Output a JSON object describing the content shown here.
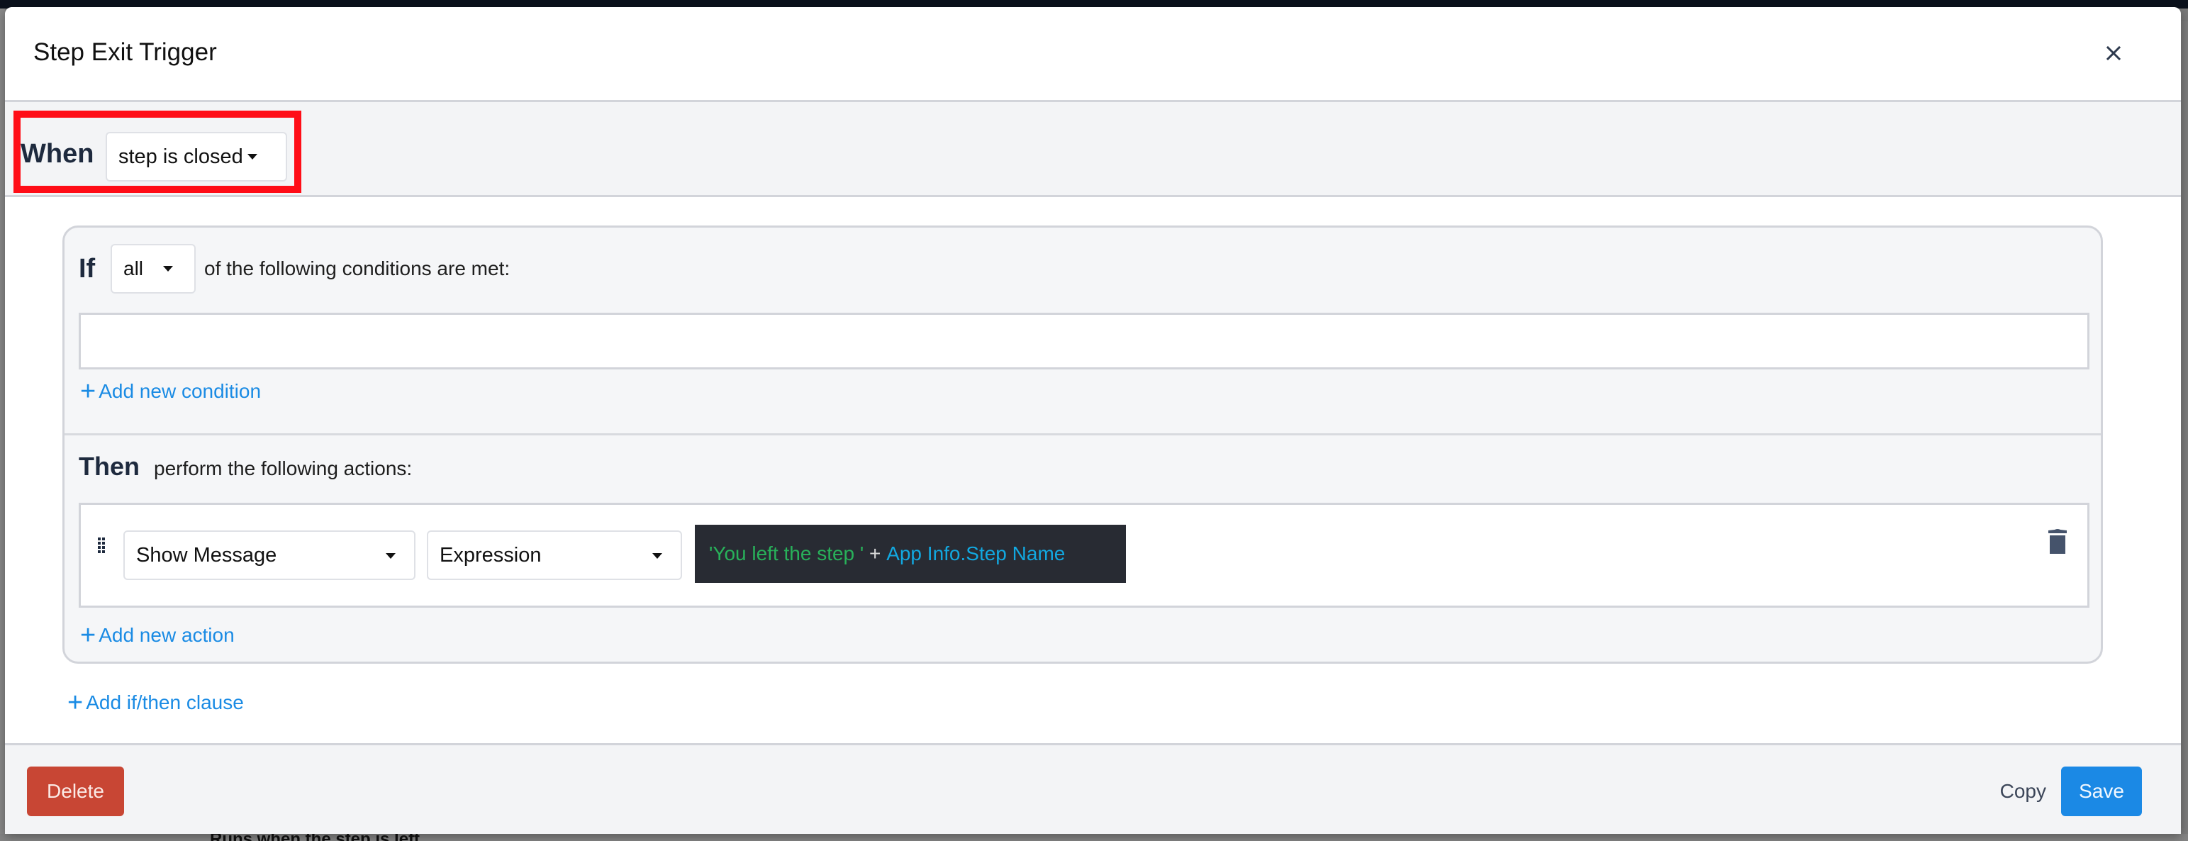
{
  "modal": {
    "title": "Step Exit Trigger",
    "close_icon": "close-icon"
  },
  "when": {
    "label": "When",
    "selected": "step is closed"
  },
  "clause": {
    "if_label": "If",
    "match_selected": "all",
    "if_suffix": "of the following conditions are met:",
    "add_condition_label": "Add new condition",
    "then_label": "Then",
    "then_suffix": "perform the following actions:",
    "actions": [
      {
        "type": "Show Message",
        "source": "Expression",
        "expression": {
          "string_literal": "'You left the step '",
          "operator": " + ",
          "reference": "App Info.Step Name"
        }
      }
    ],
    "add_action_label": "Add new action"
  },
  "add_clause_label": "Add if/then clause",
  "footer": {
    "delete_label": "Delete",
    "copy_label": "Copy",
    "save_label": "Save"
  },
  "background": {
    "partial_text": "Runs when the step is left"
  },
  "colors": {
    "primary": "#1b89e5",
    "danger": "#c84634",
    "highlight": "#ff0d17",
    "expression_string": "#28b15a",
    "expression_reference": "#12a8e0"
  }
}
